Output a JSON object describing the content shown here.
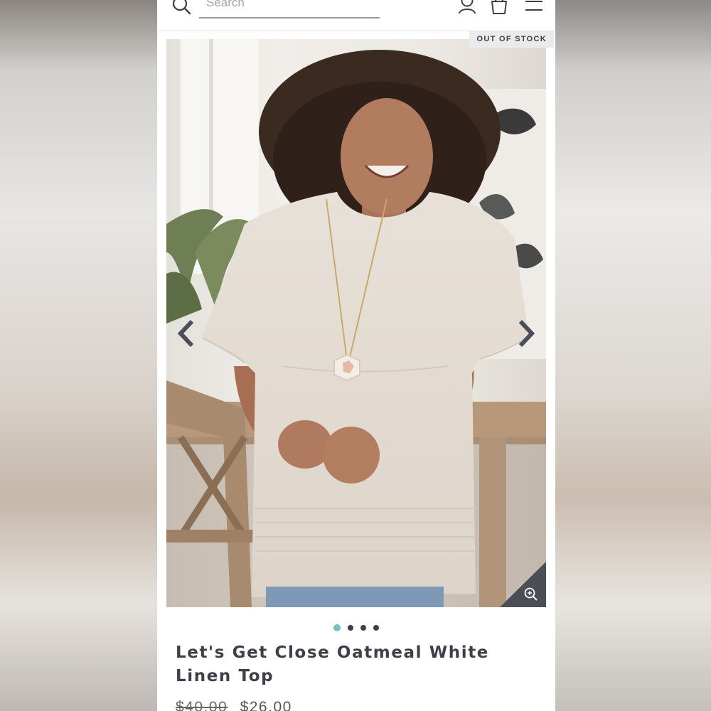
{
  "header": {
    "search_placeholder": "Search",
    "icons": [
      "search-icon",
      "account-icon",
      "shopping-bag-icon",
      "hamburger-menu-icon"
    ]
  },
  "product": {
    "stock_badge": "OUT OF STOCK",
    "title": "Let's Get Close Oatmeal White Linen Top",
    "original_price": "$40.00",
    "sale_price": "$26.00",
    "image_count": 4,
    "active_image": 1
  },
  "colors": {
    "accent_dot": "#6ec4c0",
    "text_dark": "#3d4048",
    "badge_bg": "#ebebeb"
  }
}
